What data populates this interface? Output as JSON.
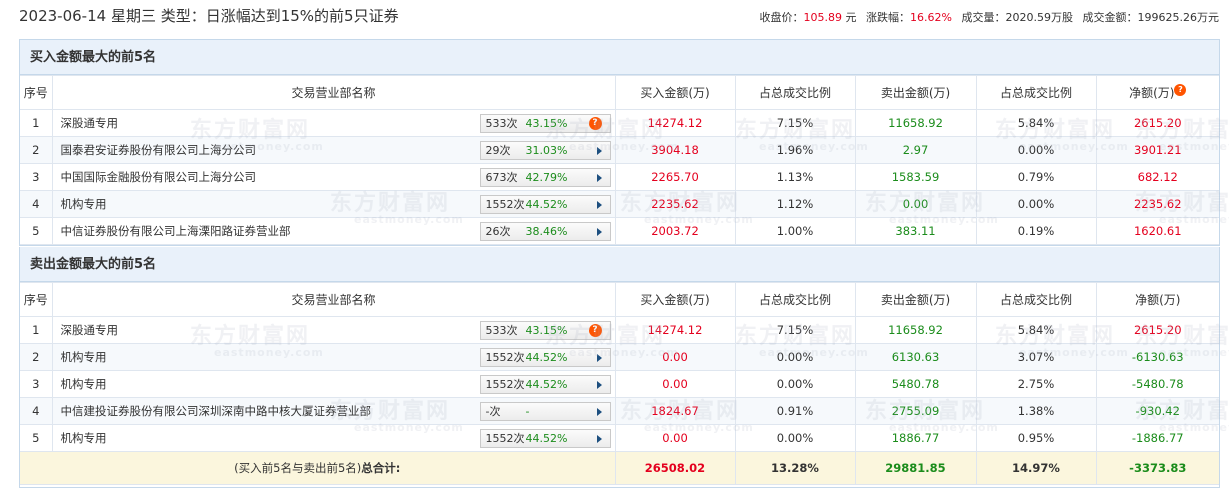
{
  "header": {
    "title": "2023-06-14 星期三 类型：日涨幅达到15%的前5只证券",
    "close_label": "收盘价：",
    "close_value": "105.89",
    "close_unit": "元",
    "change_label": "涨跌幅：",
    "change_value": "16.62%",
    "volume_label": "成交量：",
    "volume_value": "2020.59万股",
    "amount_label": "成交金额：",
    "amount_value": "199625.26万元"
  },
  "columns": {
    "idx": "序号",
    "name": "交易营业部名称",
    "buy": "买入金额(万)",
    "buy_pct": "占总成交比例",
    "sell": "卖出金额(万)",
    "sell_pct": "占总成交比例",
    "net": "净额(万)"
  },
  "buy_section": {
    "title": "买入金额最大的前5名",
    "rows": [
      {
        "idx": "1",
        "name": "深股通专用",
        "times": "533次",
        "rate": "43.15%",
        "icon": "question-icon",
        "buy": "14274.12",
        "buy_pct": "7.15%",
        "sell": "11658.92",
        "sell_pct": "5.84%",
        "net": "2615.20"
      },
      {
        "idx": "2",
        "name": "国泰君安证券股份有限公司上海分公司",
        "times": "29次",
        "rate": "31.03%",
        "icon": "play-arrow-icon",
        "buy": "3904.18",
        "buy_pct": "1.96%",
        "sell": "2.97",
        "sell_pct": "0.00%",
        "net": "3901.21"
      },
      {
        "idx": "3",
        "name": "中国国际金融股份有限公司上海分公司",
        "times": "673次",
        "rate": "42.79%",
        "icon": "play-arrow-icon",
        "buy": "2265.70",
        "buy_pct": "1.13%",
        "sell": "1583.59",
        "sell_pct": "0.79%",
        "net": "682.12"
      },
      {
        "idx": "4",
        "name": "机构专用",
        "times": "1552次",
        "rate": "44.52%",
        "icon": "play-arrow-icon",
        "buy": "2235.62",
        "buy_pct": "1.12%",
        "sell": "0.00",
        "sell_pct": "0.00%",
        "net": "2235.62"
      },
      {
        "idx": "5",
        "name": "中信证券股份有限公司上海溧阳路证券营业部",
        "times": "26次",
        "rate": "38.46%",
        "icon": "play-arrow-icon",
        "buy": "2003.72",
        "buy_pct": "1.00%",
        "sell": "383.11",
        "sell_pct": "0.19%",
        "net": "1620.61"
      }
    ]
  },
  "sell_section": {
    "title": "卖出金额最大的前5名",
    "rows": [
      {
        "idx": "1",
        "name": "深股通专用",
        "times": "533次",
        "rate": "43.15%",
        "icon": "question-icon",
        "buy": "14274.12",
        "buy_pct": "7.15%",
        "sell": "11658.92",
        "sell_pct": "5.84%",
        "net": "2615.20"
      },
      {
        "idx": "2",
        "name": "机构专用",
        "times": "1552次",
        "rate": "44.52%",
        "icon": "play-arrow-icon",
        "buy": "0.00",
        "buy_pct": "0.00%",
        "sell": "6130.63",
        "sell_pct": "3.07%",
        "net": "-6130.63"
      },
      {
        "idx": "3",
        "name": "机构专用",
        "times": "1552次",
        "rate": "44.52%",
        "icon": "play-arrow-icon",
        "buy": "0.00",
        "buy_pct": "0.00%",
        "sell": "5480.78",
        "sell_pct": "2.75%",
        "net": "-5480.78"
      },
      {
        "idx": "4",
        "name": "中信建投证券股份有限公司深圳深南中路中核大厦证券营业部",
        "times": "-次",
        "rate": "-",
        "icon": "play-arrow-icon",
        "buy": "1824.67",
        "buy_pct": "0.91%",
        "sell": "2755.09",
        "sell_pct": "1.38%",
        "net": "-930.42"
      },
      {
        "idx": "5",
        "name": "机构专用",
        "times": "1552次",
        "rate": "44.52%",
        "icon": "play-arrow-icon",
        "buy": "0.00",
        "buy_pct": "0.00%",
        "sell": "1886.77",
        "sell_pct": "0.95%",
        "net": "-1886.77"
      }
    ]
  },
  "total": {
    "label_prefix": "(买入前5名与卖出前5名)",
    "label_bold": "总合计:",
    "buy": "26508.02",
    "buy_pct": "13.28%",
    "sell": "29881.85",
    "sell_pct": "14.97%",
    "net": "-3373.83"
  },
  "watermark": {
    "text": "东方财富网",
    "sub": "eastmoney.com"
  },
  "colors": {
    "up": "#e4001e",
    "down": "#1b8c1b",
    "section_bg": "#e9f1fa",
    "total_bg": "#fbf6dd",
    "hint": "#ff5400"
  }
}
